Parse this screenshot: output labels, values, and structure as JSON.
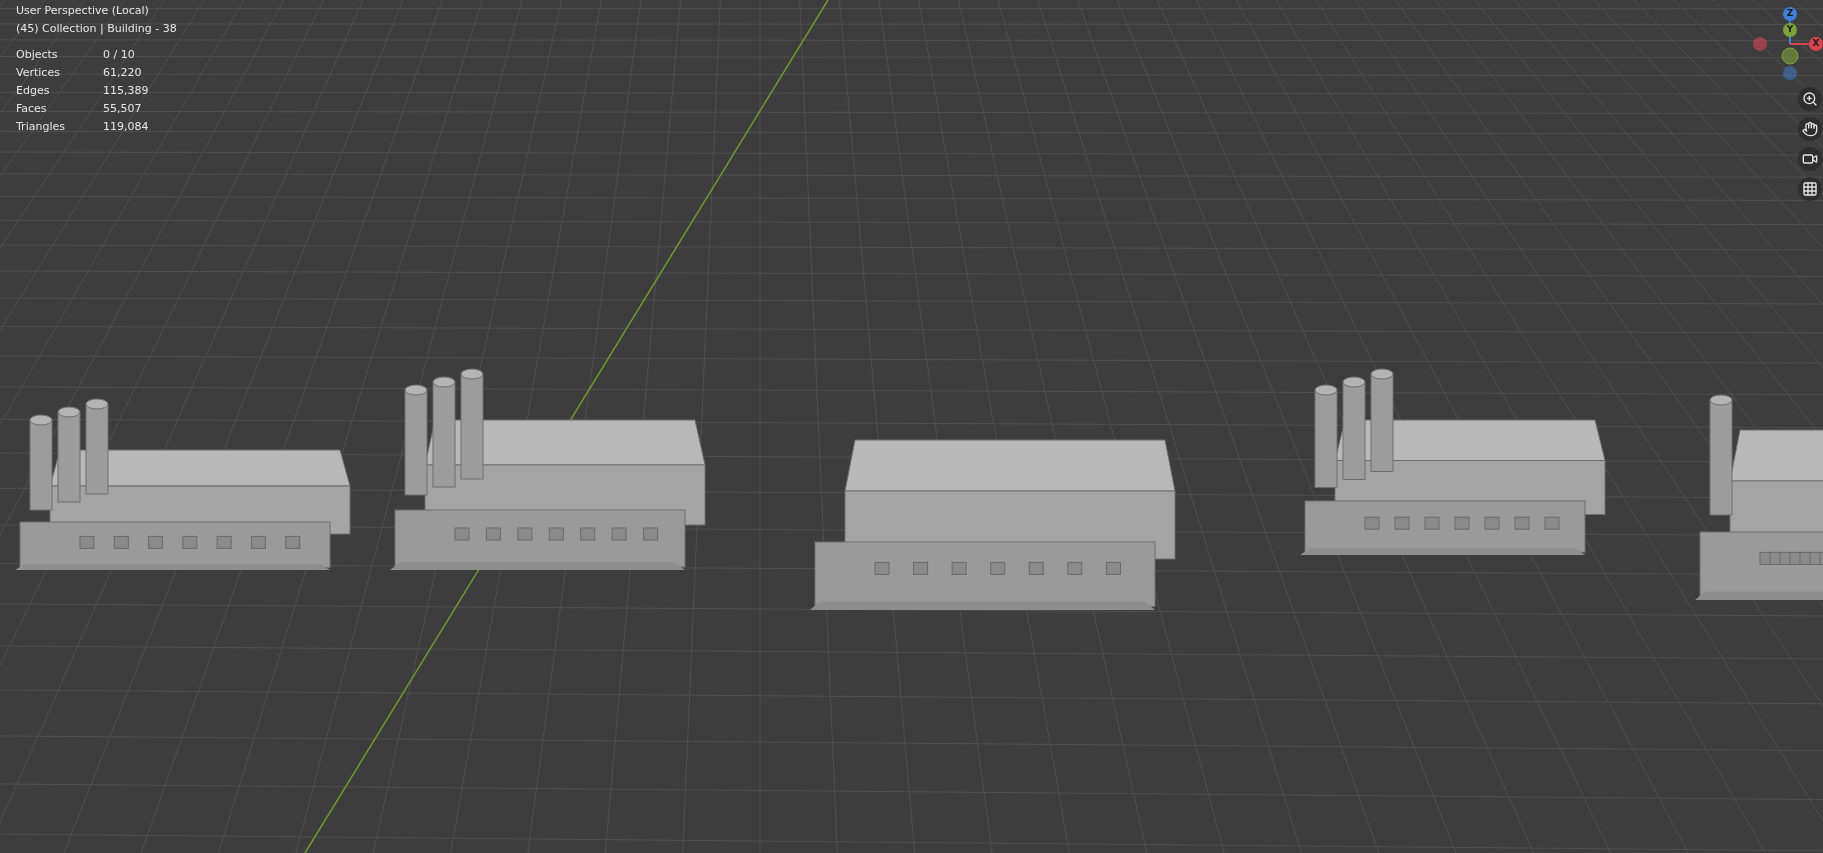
{
  "viewport": {
    "view_name": "User Perspective (Local)",
    "active_object": "(45) Collection | Building - 38"
  },
  "statistics": [
    {
      "label": "Objects",
      "value": "0 / 10"
    },
    {
      "label": "Vertices",
      "value": "61,220"
    },
    {
      "label": "Edges",
      "value": "115,389"
    },
    {
      "label": "Faces",
      "value": "55,507"
    },
    {
      "label": "Triangles",
      "value": "119,084"
    }
  ],
  "gizmo": {
    "axes": [
      {
        "label": "Z",
        "color": "#3d7fd9"
      },
      {
        "label": "Y",
        "color": "#7aa23a"
      },
      {
        "label": "X",
        "color": "#d9424f"
      }
    ]
  }
}
